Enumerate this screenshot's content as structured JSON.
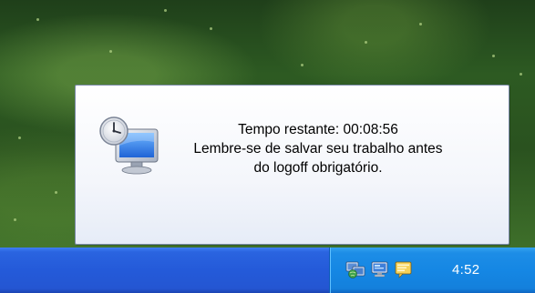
{
  "notification": {
    "line1": "Tempo restante:  00:08:56",
    "line2": "Lembre-se de salvar seu trabalho antes",
    "line3": "do logoff obrigatório.",
    "icon": "clock-computer-icon"
  },
  "taskbar": {
    "tray_icons": [
      "network-icon",
      "display-icon",
      "messenger-icon"
    ],
    "clock": "4:52"
  }
}
